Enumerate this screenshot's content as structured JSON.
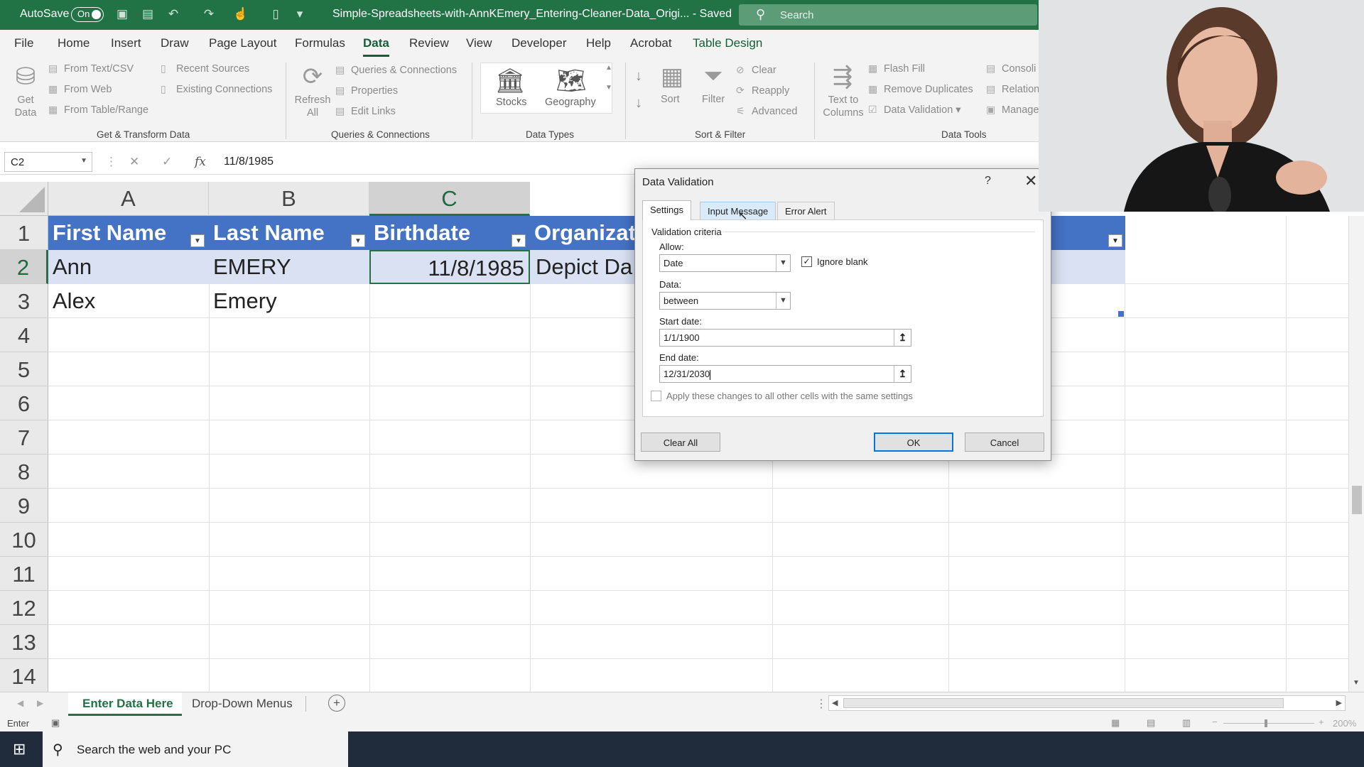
{
  "titlebar": {
    "autosave_label": "AutoSave",
    "autosave_state": "On",
    "document_title": "Simple-Spreadsheets-with-AnnKEmery_Entering-Cleaner-Data_Origi... - Saved",
    "search_placeholder": "Search"
  },
  "ribbon_tabs": [
    "File",
    "Home",
    "Insert",
    "Draw",
    "Page Layout",
    "Formulas",
    "Data",
    "Review",
    "View",
    "Developer",
    "Help",
    "Acrobat",
    "Table Design"
  ],
  "ribbon": {
    "get_data": "Get Data",
    "from_text_csv": "From Text/CSV",
    "from_web": "From Web",
    "from_table_range": "From Table/Range",
    "recent_sources": "Recent Sources",
    "existing_connections": "Existing Connections",
    "group_get_transform": "Get & Transform Data",
    "refresh_all": "Refresh All",
    "queries_connections": "Queries & Connections",
    "properties": "Properties",
    "edit_links": "Edit Links",
    "group_queries": "Queries & Connections",
    "stocks": "Stocks",
    "geography": "Geography",
    "group_data_types": "Data Types",
    "sort": "Sort",
    "filter": "Filter",
    "clear": "Clear",
    "reapply": "Reapply",
    "advanced": "Advanced",
    "group_sort_filter": "Sort & Filter",
    "text_to_columns": "Text to Columns",
    "flash_fill": "Flash Fill",
    "remove_duplicates": "Remove Duplicates",
    "data_validation": "Data Validation",
    "consolidate": "Consoli",
    "relationships": "Relation",
    "manage": "Manage",
    "group_data_tools": "Data Tools"
  },
  "formula_bar": {
    "name_box": "C2",
    "content": "11/8/1985"
  },
  "grid": {
    "columns": [
      "A",
      "B",
      "C"
    ],
    "rows": [
      "1",
      "2",
      "3",
      "4",
      "5",
      "6",
      "7",
      "8",
      "9",
      "10",
      "11",
      "12",
      "13",
      "14"
    ],
    "header_cells": [
      "First Name",
      "Last Name",
      "Birthdate",
      "Organizat"
    ],
    "row2": [
      "Ann",
      "EMERY",
      "11/8/1985",
      "Depict Da"
    ],
    "row3": [
      "Alex",
      "Emery"
    ]
  },
  "sheet_tabs": [
    "Enter Data Here",
    "Drop-Down Menus"
  ],
  "status": {
    "mode": "Enter",
    "zoom": "200%"
  },
  "taskbar": {
    "search_placeholder": "Search the web and your PC"
  },
  "dialog": {
    "title": "Data Validation",
    "help": "?",
    "tabs": [
      "Settings",
      "Input Message",
      "Error Alert"
    ],
    "section": "Validation criteria",
    "allow_label": "Allow:",
    "allow_value": "Date",
    "ignore_blank": "Ignore blank",
    "ignore_blank_checked": true,
    "data_label": "Data:",
    "data_value": "between",
    "start_label": "Start date:",
    "start_value": "1/1/1900",
    "end_label": "End date:",
    "end_value": "12/31/2030",
    "apply_all": "Apply these changes to all other cells with the same settings",
    "clear_all": "Clear All",
    "ok": "OK",
    "cancel": "Cancel"
  },
  "colors": {
    "excel_green": "#217346",
    "table_header_blue": "#4472c4",
    "table_row_blue": "#d9e1f2",
    "taskbar": "#202b3b"
  }
}
